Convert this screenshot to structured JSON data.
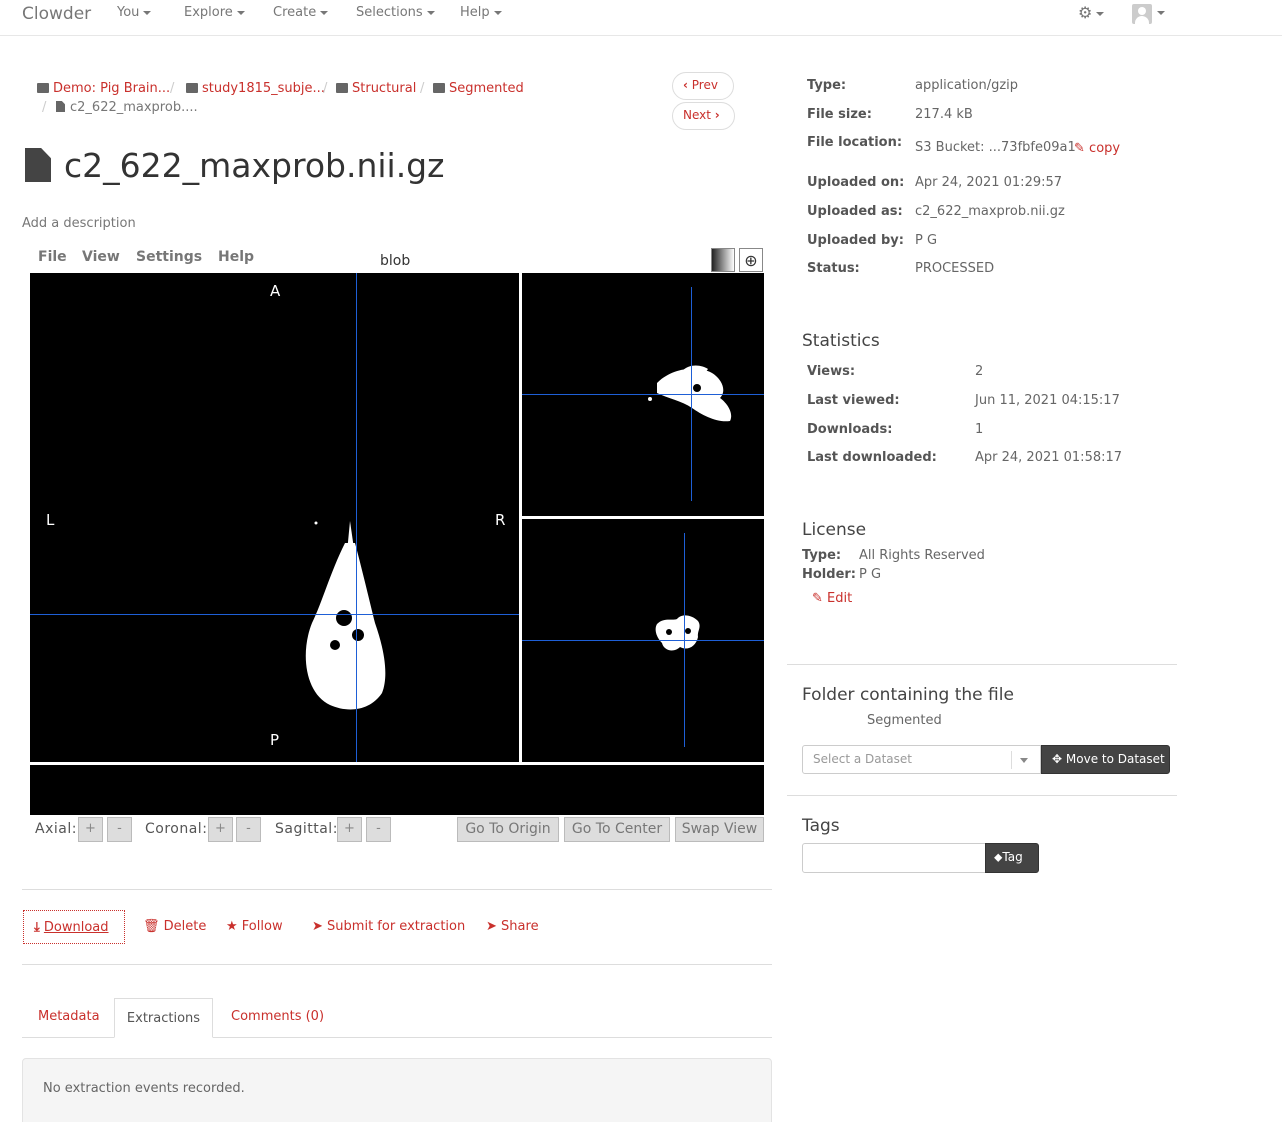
{
  "navbar": {
    "brand": "Clowder",
    "items": [
      "You",
      "Explore",
      "Create",
      "Selections",
      "Help"
    ]
  },
  "breadcrumb": {
    "items": [
      "Demo: Pig Brain...",
      "study1815_subje...",
      "Structural",
      "Segmented"
    ],
    "current": "c2_622_maxprob...."
  },
  "pager": {
    "prev": "Prev",
    "next": "Next"
  },
  "file": {
    "title": "c2_622_maxprob.nii.gz",
    "add_description": "Add a description"
  },
  "viewer": {
    "menu": [
      "File",
      "View",
      "Settings",
      "Help"
    ],
    "label": "blob",
    "orientation": {
      "top": "A",
      "bottom": "P",
      "left": "L",
      "right": "R"
    },
    "controls": {
      "axial": "Axial:",
      "coronal": "Coronal:",
      "sagittal": "Sagittal:",
      "plus": "+",
      "minus": "-",
      "go_to_origin": "Go To Origin",
      "go_to_center": "Go To Center",
      "swap_view": "Swap View"
    }
  },
  "actions": {
    "download": "Download",
    "delete": "Delete",
    "follow": "Follow",
    "submit": "Submit for extraction",
    "share": "Share"
  },
  "tabs": {
    "metadata": "Metadata",
    "extractions": "Extractions",
    "comments": "Comments (0)",
    "active": "Extractions",
    "empty_message": "No extraction events recorded."
  },
  "info": {
    "type_label": "Type:",
    "type": "application/gzip",
    "size_label": "File size:",
    "size": "217.4 kB",
    "location_label": "File location:",
    "location": "S3 Bucket: ...73fbfe09a1",
    "copy": "copy",
    "uploaded_on_label": "Uploaded on:",
    "uploaded_on": "Apr 24, 2021 01:29:57",
    "uploaded_as_label": "Uploaded as:",
    "uploaded_as": "c2_622_maxprob.nii.gz",
    "uploaded_by_label": "Uploaded by:",
    "uploaded_by": "P G",
    "status_label": "Status:",
    "status": "PROCESSED"
  },
  "statistics": {
    "heading": "Statistics",
    "views_label": "Views:",
    "views": "2",
    "last_viewed_label": "Last viewed:",
    "last_viewed": "Jun 11, 2021 04:15:17",
    "downloads_label": "Downloads:",
    "downloads": "1",
    "last_downloaded_label": "Last downloaded:",
    "last_downloaded": "Apr 24, 2021 01:58:17"
  },
  "license": {
    "heading": "License",
    "type_label": "Type:",
    "type": "All Rights Reserved",
    "holder_label": "Holder:",
    "holder": "P G",
    "edit": "Edit"
  },
  "folder": {
    "heading": "Folder containing the file",
    "name": "Segmented",
    "select_placeholder": "Select a Dataset",
    "move_button": "Move to Dataset"
  },
  "tags": {
    "heading": "Tags",
    "button": "Tag"
  }
}
